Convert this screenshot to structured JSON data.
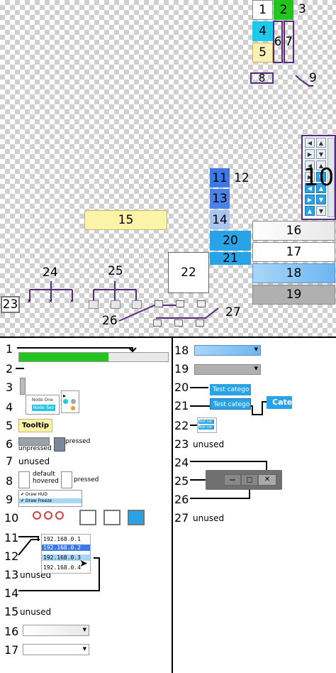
{
  "atlas": {
    "labels": [
      "1",
      "2",
      "3",
      "4",
      "5",
      "6",
      "7",
      "8",
      "9",
      "10",
      "11",
      "12",
      "13",
      "14",
      "15",
      "16",
      "17",
      "18",
      "19",
      "20",
      "21",
      "22",
      "23",
      "24",
      "25",
      "26",
      "27"
    ]
  },
  "legend_left": {
    "numbers": [
      "1",
      "2",
      "3",
      "4",
      "5",
      "6",
      "7",
      "8",
      "9",
      "10",
      "11",
      "12",
      "13",
      "14",
      "15",
      "16",
      "17"
    ],
    "unused": "unused",
    "node_one": "Node One",
    "node_two": "Node Two",
    "tooltip": "Tooltip",
    "unpressed": "unpressed",
    "pressed": "pressed",
    "default": "default",
    "hovered": "hovered",
    "pressed2": "pressed",
    "draw_hud": "Draw HUD",
    "draw_freeze": "Draw Freeze",
    "ips": [
      "192.168.0.1",
      "192.168.0.2",
      "192.168.0.3",
      "192.168.0.4"
    ]
  },
  "legend_right": {
    "numbers": [
      "18",
      "19",
      "20",
      "21",
      "22",
      "23",
      "24",
      "25",
      "26",
      "27"
    ],
    "unused": "unused",
    "test_category_1": "Test catego",
    "test_category_2": "Test catego",
    "cate": "Cate",
    "test_cat_small_1": "Test cat",
    "test_cat_small_2": "Test cat"
  },
  "colors": {
    "green": "#22c41e",
    "cyan": "#1ec8e8",
    "cream": "#fbf0b6",
    "blue": "#3a79e6",
    "sky": "#27a3e6",
    "yellow": "#fbf4a8",
    "purple": "#5a2a7a"
  }
}
